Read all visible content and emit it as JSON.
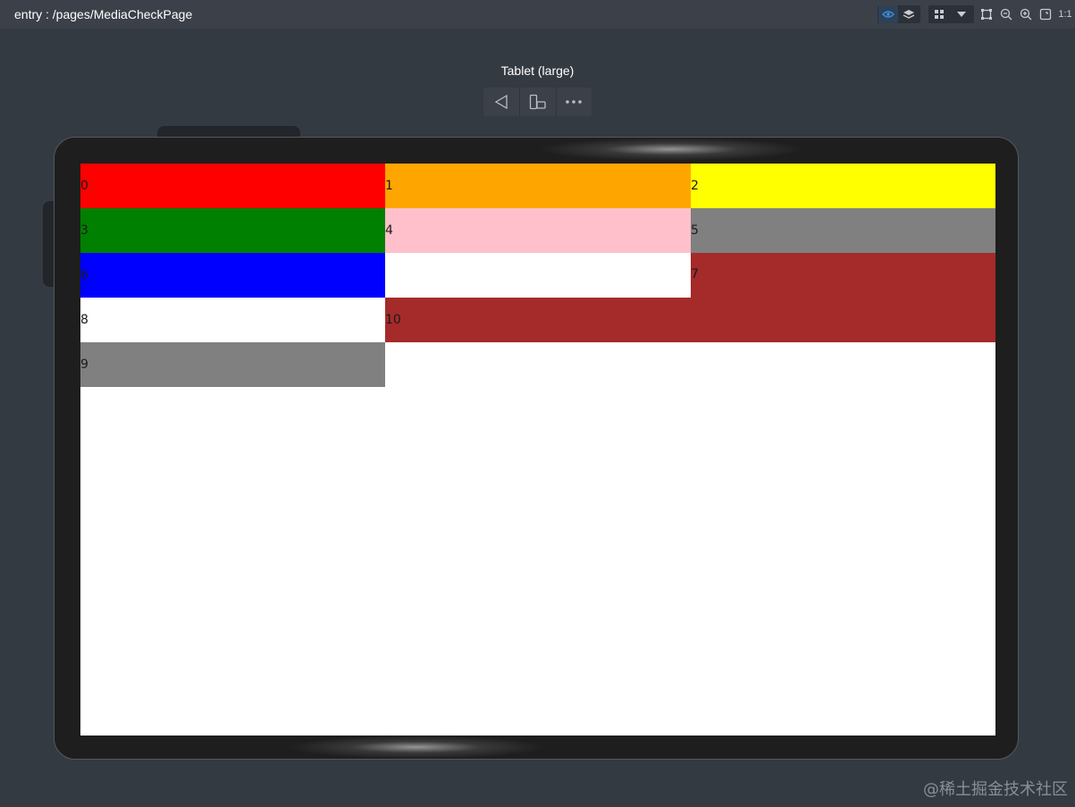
{
  "window": {
    "title": "entry : /pages/MediaCheckPage"
  },
  "toolbar": {
    "icons": [
      "eye-icon",
      "layers-icon",
      "grid-icon",
      "dropdown-icon",
      "fit-icon",
      "zoom-out-icon",
      "zoom-in-icon",
      "fullscreen-icon",
      "actual-size-icon"
    ],
    "actual_size_label": "1:1"
  },
  "device": {
    "label": "Tablet (large)",
    "controls": [
      "rotate-back-icon",
      "device-rotate-icon",
      "more-icon"
    ]
  },
  "grid_items": [
    {
      "label": "0",
      "color": "#ff0000"
    },
    {
      "label": "1",
      "color": "#ffa500"
    },
    {
      "label": "2",
      "color": "#ffff00"
    },
    {
      "label": "3",
      "color": "#008000"
    },
    {
      "label": "4",
      "color": "#ffc0cb"
    },
    {
      "label": "5",
      "color": "#808080"
    },
    {
      "label": "6",
      "color": "#0000ff"
    },
    {
      "label": "7",
      "color": "#a52a2a"
    },
    {
      "label": "8",
      "color": "#ffffff"
    },
    {
      "label": "9",
      "color": "#808080"
    },
    {
      "label": "10",
      "color": "#a52a2a"
    }
  ],
  "watermark": "@稀土掘金技术社区"
}
